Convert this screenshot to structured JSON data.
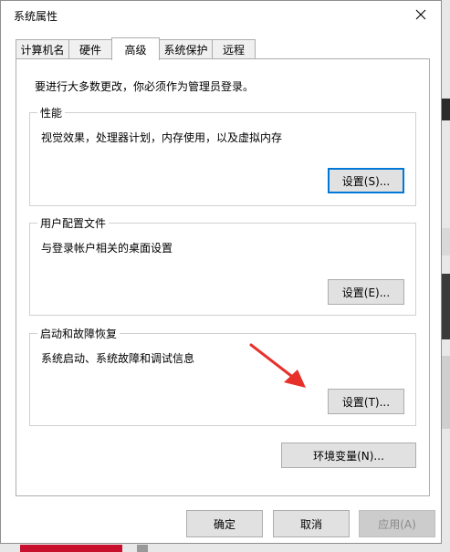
{
  "window": {
    "title": "系统属性"
  },
  "tabs": [
    {
      "label": "计算机名"
    },
    {
      "label": "硬件"
    },
    {
      "label": "高级"
    },
    {
      "label": "系统保护"
    },
    {
      "label": "远程"
    }
  ],
  "active_tab": "高级",
  "intro_text": "要进行大多数更改，你必须作为管理员登录。",
  "performance": {
    "title": "性能",
    "desc": "视觉效果，处理器计划，内存使用，以及虚拟内存",
    "button": "设置(S)..."
  },
  "profile": {
    "title": "用户配置文件",
    "desc": "与登录帐户相关的桌面设置",
    "button": "设置(E)..."
  },
  "startup": {
    "title": "启动和故障恢复",
    "desc": "系统启动、系统故障和调试信息",
    "button": "设置(T)..."
  },
  "env_button": "环境变量(N)...",
  "footer": {
    "ok": "确定",
    "cancel": "取消",
    "apply": "应用(A)"
  },
  "colors": {
    "focus_border": "#0078d7",
    "annotation_arrow": "#e8302b"
  },
  "icons": {
    "close": "close-icon",
    "arrow": "red-arrow-annotation"
  }
}
